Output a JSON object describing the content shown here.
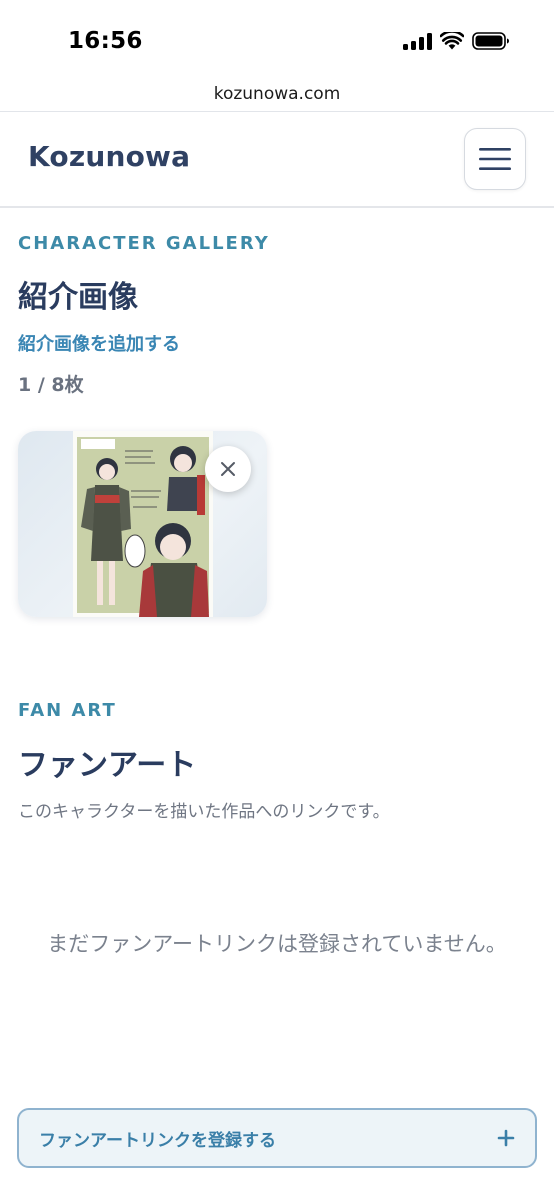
{
  "status_bar": {
    "time": "16:56"
  },
  "browser": {
    "url": "kozunowa.com"
  },
  "header": {
    "brand": "Kozunowa"
  },
  "gallery": {
    "eyebrow": "CHARACTER GALLERY",
    "title": "紹介画像",
    "add_link": "紹介画像を追加する",
    "count": "1 / 8枚",
    "images": [
      {
        "alt": "character reference sheet"
      }
    ]
  },
  "fanart": {
    "eyebrow": "FAN ART",
    "title": "ファンアート",
    "description": "このキャラクターを描いた作品へのリンクです。",
    "empty_message": "まだファンアートリンクは登録されていません。",
    "register_button": "ファンアートリンクを登録する"
  },
  "colors": {
    "accent": "#3d8aa8",
    "heading": "#2a3c5f",
    "link": "#3a86b4"
  },
  "icons": {
    "menu": "hamburger-menu-icon",
    "remove": "close-icon",
    "add": "plus-icon"
  }
}
